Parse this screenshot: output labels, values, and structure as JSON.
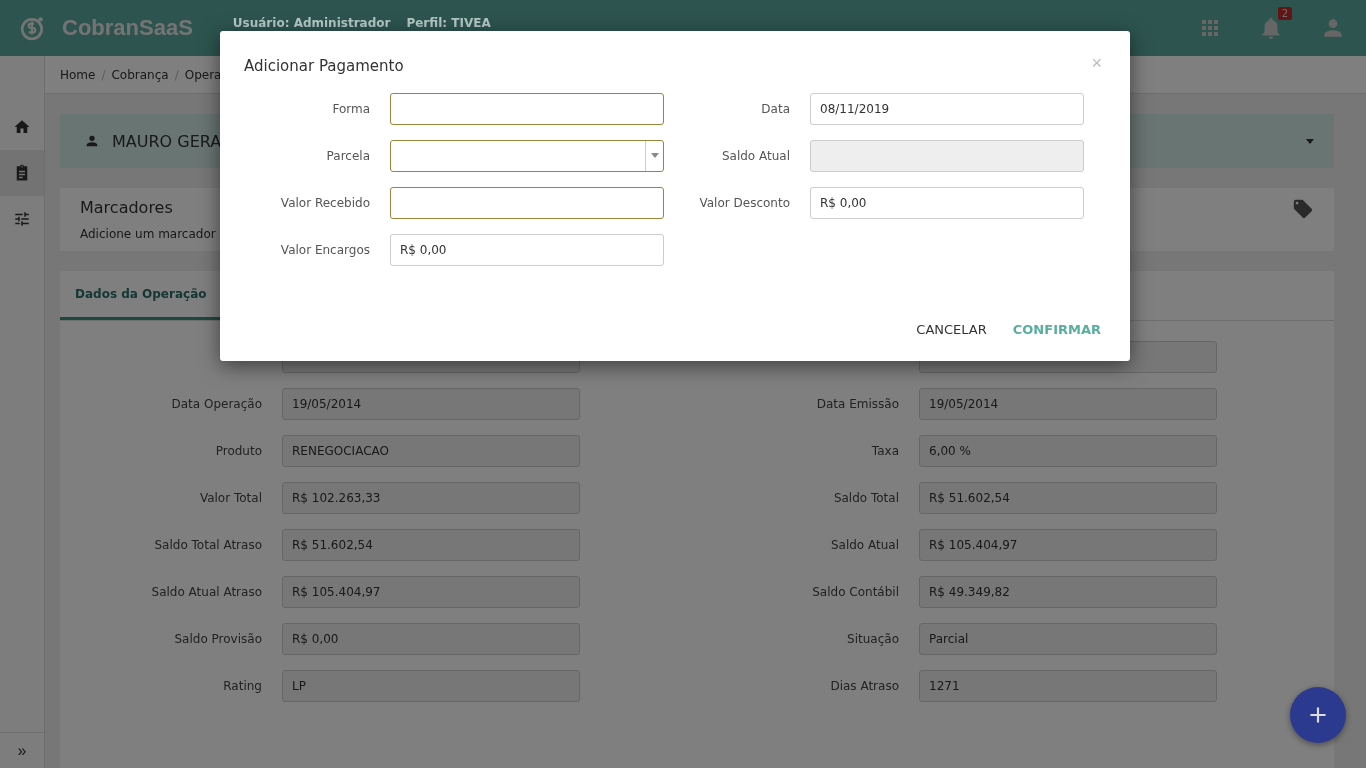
{
  "header": {
    "logo": "CobranSaaS",
    "user_label": "Usuário:",
    "user": "Administrador",
    "profile_label": "Perfil:",
    "profile": "TIVEA",
    "notifications": "2"
  },
  "breadcrumb": [
    "Home",
    "Cobrança",
    "Opera"
  ],
  "breadcrumb_separator": "/",
  "client": {
    "name": "MAURO GERA"
  },
  "markers": {
    "title": "Marcadores",
    "hint": "Adicione um marcador"
  },
  "tabs": [
    {
      "label": "Dados da Operação",
      "selected": true
    }
  ],
  "fields": [
    {
      "label": "Data Operação",
      "value": "19/05/2014"
    },
    {
      "label": "Data Emissão",
      "value": "19/05/2014"
    },
    {
      "label": "Produto",
      "value": "RENEGOCIACAO"
    },
    {
      "label": "Taxa",
      "value": "6,00 %"
    },
    {
      "label": "Valor Total",
      "value": "R$ 102.263,33"
    },
    {
      "label": "Saldo Total",
      "value": "R$ 51.602,54"
    },
    {
      "label": "Saldo Total Atraso",
      "value": "R$ 51.602,54"
    },
    {
      "label": "Saldo Atual",
      "value": "R$ 105.404,97"
    },
    {
      "label": "Saldo Atual Atraso",
      "value": "R$ 105.404,97"
    },
    {
      "label": "Saldo Contábil",
      "value": "R$ 49.349,82"
    },
    {
      "label": "Saldo Provisão",
      "value": "R$ 0,00"
    },
    {
      "label": "Situação",
      "value": "Parcial"
    },
    {
      "label": "Rating",
      "value": "LP"
    },
    {
      "label": "Dias Atraso",
      "value": "1271"
    }
  ],
  "sidebar_toggle": "»",
  "dialog": {
    "title": "Adicionar Pagamento",
    "close": "×",
    "left": [
      {
        "label": "Forma",
        "kind": "text",
        "required": true
      },
      {
        "label": "Parcela",
        "kind": "select",
        "required": true
      },
      {
        "label": "Valor Recebido",
        "kind": "text",
        "required": true
      },
      {
        "label": "Valor Encargos",
        "kind": "text",
        "required": false,
        "value": "R$ 0,00"
      }
    ],
    "right": [
      {
        "label": "Data",
        "kind": "text",
        "required": false,
        "value": "08/11/2019"
      },
      {
        "label": "Saldo Atual",
        "kind": "disabled",
        "required": false
      },
      {
        "label": "Valor Desconto",
        "kind": "text",
        "required": false,
        "value": "R$ 0,00"
      }
    ],
    "buttons": [
      {
        "label": "CANCELAR",
        "kind": "plain"
      },
      {
        "label": "CONFIRMAR",
        "kind": "primary"
      }
    ]
  }
}
